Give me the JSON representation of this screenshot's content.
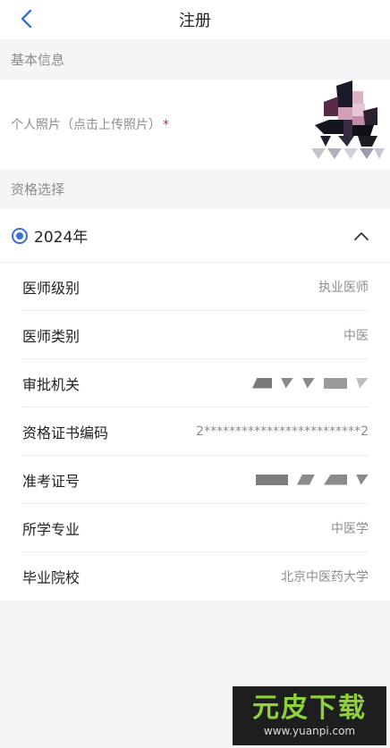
{
  "nav": {
    "title": "注册",
    "back_icon": "chevron-left-icon"
  },
  "sections": {
    "basic": "基本信息",
    "qualification": "资格选择"
  },
  "photo": {
    "label": "个人照片（点击上传照片）",
    "required_mark": "*"
  },
  "year": {
    "label": "2024年",
    "selected": true,
    "expanded": true
  },
  "fields": [
    {
      "name": "医师级别",
      "value": "执业医师"
    },
    {
      "name": "医师类别",
      "value": "中医"
    },
    {
      "name": "审批机关",
      "value": ""
    },
    {
      "name": "资格证书编码",
      "value": "2*************************2"
    },
    {
      "name": "准考证号",
      "value": ""
    },
    {
      "name": "所学专业",
      "value": "中医学"
    },
    {
      "name": "毕业院校",
      "value": "北京中医药大学"
    }
  ],
  "watermark": {
    "big": "元皮下载",
    "small": "www.yuanpi.com"
  },
  "colors": {
    "accent": "#3a6fd8",
    "required": "#e02020",
    "watermark_green": "#8fd13a"
  }
}
